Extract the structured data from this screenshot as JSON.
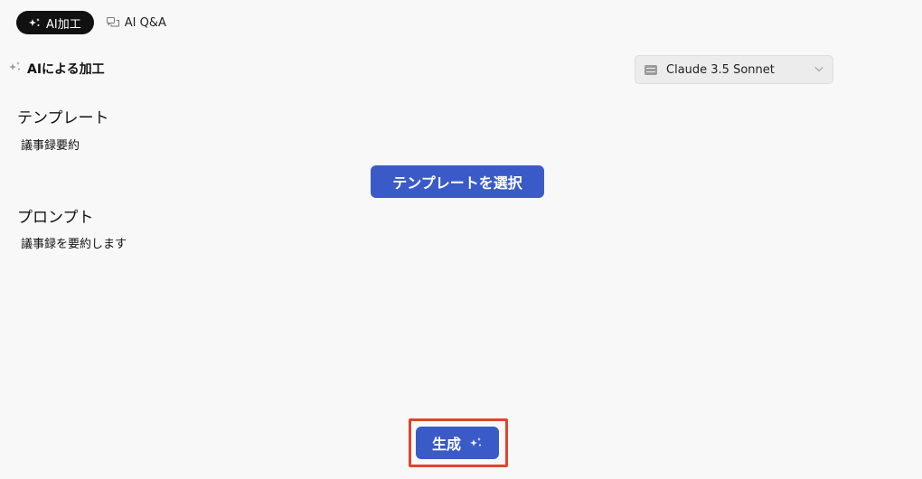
{
  "tabs": [
    {
      "label": "AI加工",
      "icon": "sparkle-icon",
      "active": true
    },
    {
      "label": "AI Q&A",
      "icon": "chat-icon",
      "active": false
    }
  ],
  "section": {
    "title": "AIによる加工",
    "icon": "sparkle-icon"
  },
  "model_select": {
    "value": "Claude 3.5 Sonnet",
    "icon": "model-icon"
  },
  "template": {
    "title": "テンプレート",
    "value": "議事録要約",
    "button_label": "テンプレートを選択"
  },
  "prompt": {
    "title": "プロンプト",
    "value": "議事録を要約します"
  },
  "generate": {
    "label": "生成",
    "icon": "sparkle-icon"
  },
  "colors": {
    "primary": "#3a5bc7",
    "highlight": "#e0452b",
    "active_tab": "#111111"
  }
}
